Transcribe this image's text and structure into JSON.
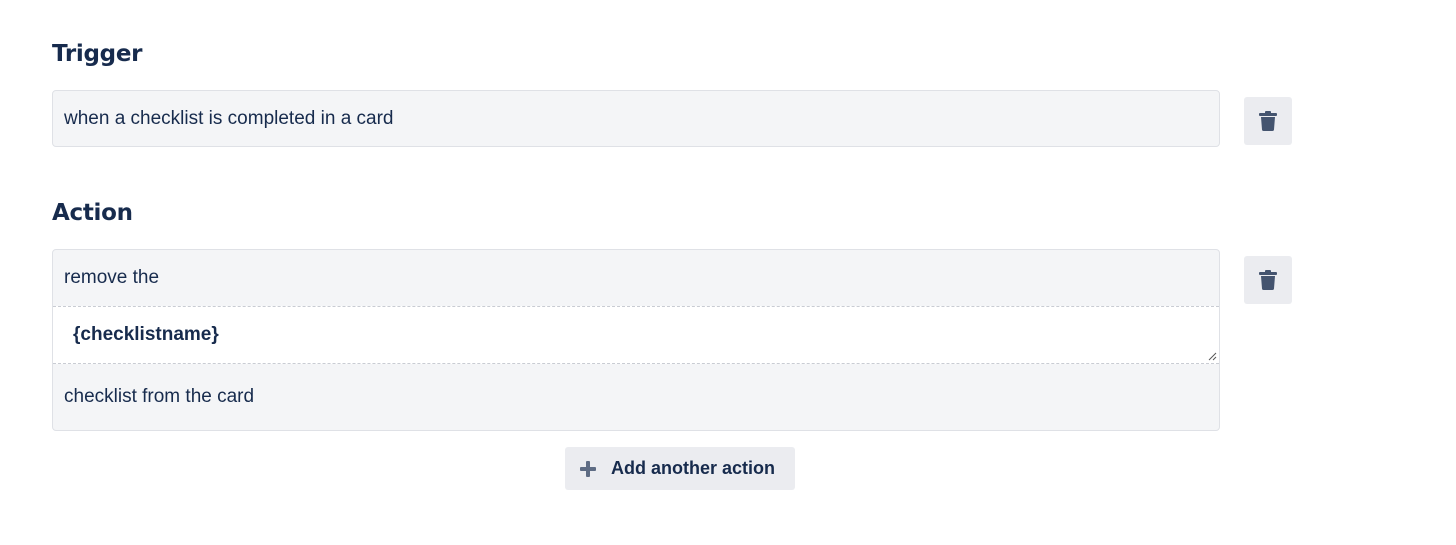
{
  "trigger": {
    "heading": "Trigger",
    "text": "when a checklist is completed in a card",
    "delete_icon": "trash-icon"
  },
  "action": {
    "heading": "Action",
    "line_before": "remove the",
    "field_value": "{checklistname}",
    "line_after": "checklist from the card",
    "delete_icon": "trash-icon"
  },
  "add_action": {
    "label": "Add another action",
    "icon": "plus-icon"
  },
  "colors": {
    "text": "#172b4d",
    "box_bg": "#f4f5f7",
    "button_bg": "#ebecf0",
    "icon": "#44546f"
  }
}
